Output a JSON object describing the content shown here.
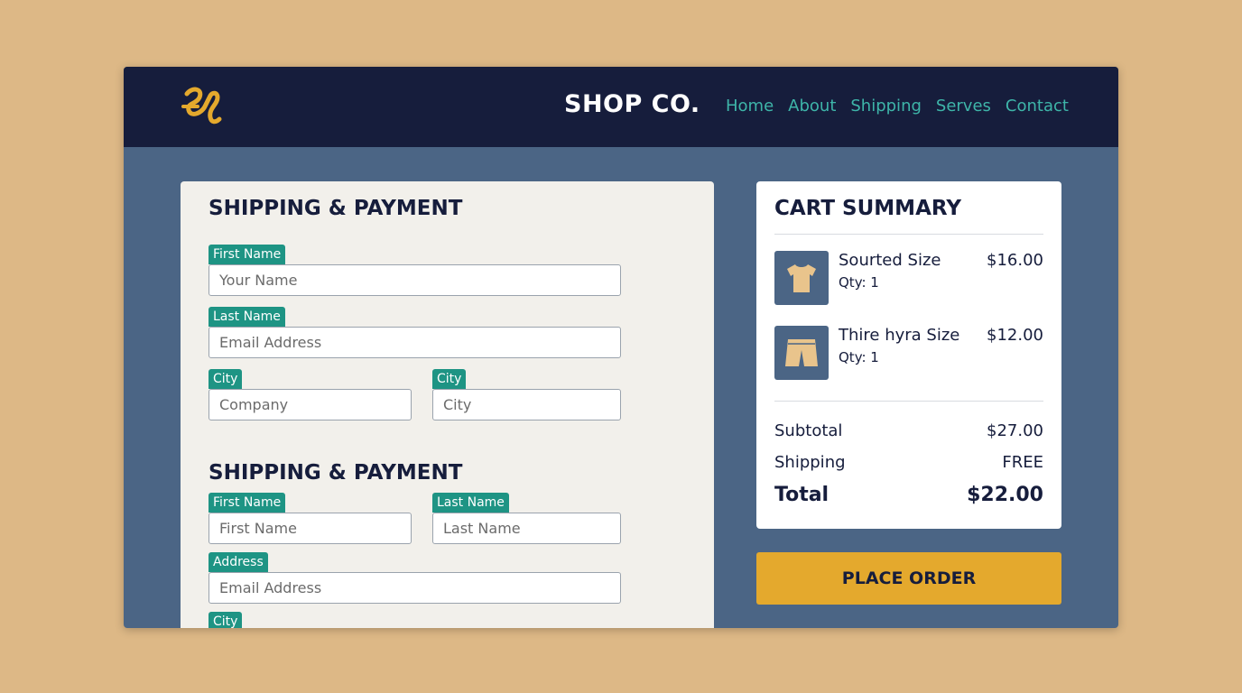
{
  "colors": {
    "page_background": "#ddb886",
    "header_background": "#161d3c",
    "content_background": "#4b6585",
    "nav_link": "#3eb5a9",
    "label_badge": "#1e9484",
    "accent_button": "#e4a92d",
    "logo": "#e4a92d"
  },
  "header": {
    "logo_icon": "monogram-logo",
    "brand": "SHOP CO.",
    "nav": [
      "Home",
      "About",
      "Shipping",
      "Serves",
      "Contact"
    ]
  },
  "form": {
    "section1": {
      "title": "SHIPPING & PAYMENT",
      "fields": [
        {
          "label": "First Name",
          "placeholder": "Your Name"
        },
        {
          "label": "Last Name",
          "placeholder": "Email Address"
        },
        {
          "label": "City",
          "placeholder": "Company"
        },
        {
          "label": "City",
          "placeholder": "City"
        }
      ]
    },
    "section2": {
      "title": "SHIPPING & PAYMENT",
      "fields": [
        {
          "label": "First Name",
          "placeholder": "First Name"
        },
        {
          "label": "Last Name",
          "placeholder": "Last Name"
        },
        {
          "label": "Address",
          "placeholder": "Email Address"
        },
        {
          "label": "City",
          "placeholder": ""
        }
      ]
    }
  },
  "cart": {
    "title": "CART SUMMARY",
    "items": [
      {
        "name": "Sourted Size",
        "qty": "Qty: 1",
        "price": "$16.00",
        "icon": "tshirt-icon"
      },
      {
        "name": "Thire hyra Size",
        "qty": "Qty: 1",
        "price": "$12.00",
        "icon": "shorts-icon"
      }
    ],
    "subtotal_label": "Subtotal",
    "subtotal_value": "$27.00",
    "shipping_label": "Shipping",
    "shipping_value": "FREE",
    "total_label": "Total",
    "total_value": "$22.00"
  },
  "place_order": "PLACE ORDER"
}
